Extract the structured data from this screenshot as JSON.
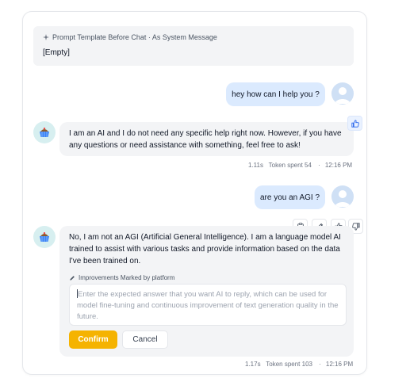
{
  "system_prompt": {
    "label": "Prompt Template Before Chat · As System Message",
    "value": "[Empty]"
  },
  "messages": [
    {
      "role": "user",
      "text": "hey how can I help you ?"
    },
    {
      "role": "assistant",
      "text": "I am an AI and I do not need any specific help right now. However, if you have any questions or need assistance with something, feel free to ask!",
      "time_taken": "1.11s",
      "tokens": "Token spent 54",
      "timestamp": "12:16 PM"
    },
    {
      "role": "user",
      "text": "are you an AGI ?"
    },
    {
      "role": "assistant",
      "text": "No, I am not an AGI (Artificial General Intelligence). I am a language model AI trained to assist with various tasks and provide information based on the data I've been trained on.",
      "time_taken": "1.17s",
      "tokens": "Token spent 103",
      "timestamp": "12:16 PM"
    }
  ],
  "improvement": {
    "label": "Improvements Marked by platform",
    "placeholder": "Enter the expected answer that you want AI to reply, which can be used for model fine-tuning and continuous improvement of text generation quality in the future.",
    "confirm_label": "Confirm",
    "cancel_label": "Cancel"
  },
  "icons": {
    "system_prompt": "sparkle-icon",
    "feedback_liked": "thumbs-up-icon",
    "toolbar": [
      "clipboard-icon",
      "pencil-icon",
      "thumbs-up-icon",
      "thumbs-down-icon"
    ],
    "improvement": "pencil-icon"
  },
  "colors": {
    "accent": "#f5b301",
    "user_bubble": "#dbeafe",
    "bot_bubble": "#f3f4f6",
    "like_active": "#2563eb"
  }
}
